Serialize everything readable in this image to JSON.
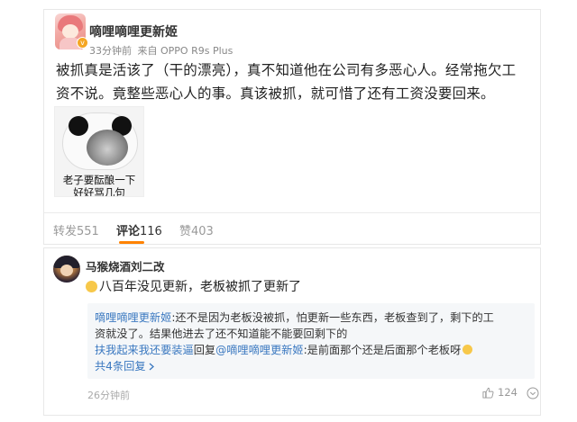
{
  "post": {
    "username": "嘀哩嘀哩更新姬",
    "time": "33分钟前",
    "source_prefix": "来自",
    "source": "OPPO R9s Plus",
    "text": "被抓真是活该了（干的漂亮），真不知道他在公司有多恶心人。经常拖欠工资不说。竟整些恶心人的事。真该被抓，就可惜了还有工资没要回来。",
    "meme_caption_line1": "老子要酝酿一下",
    "meme_caption_line2": "好好骂几句"
  },
  "tabs": [
    {
      "label": "转发",
      "count": "551"
    },
    {
      "label": "评论",
      "count": "116"
    },
    {
      "label": "赞",
      "count": "403"
    }
  ],
  "comment": {
    "username": "马猴烧酒刘二改",
    "text": "八百年没见更新，老板被抓了更新了",
    "reply1_user": "嘀哩嘀哩更新姬",
    "reply1_text_a": ":还不是因为老板没被抓，怕更新一些东西，老板查到了，剩下的工",
    "reply1_text_b": "资就没了。结果他进去了还不知道能不能要回剩下的",
    "reply2_user": "扶我起来我还要装逼",
    "reply2_mid": "回复",
    "reply2_target": "@嘀哩嘀哩更新姬",
    "reply2_text": ":是前面那个还是后面那个老板呀",
    "more_replies": "共4条回复",
    "time": "26分钟前",
    "likes": "124"
  },
  "colors": {
    "accent": "#ff8200",
    "link": "#3a78c0",
    "badge": "#f5a623"
  },
  "icons": {
    "verified": "verified-badge-icon",
    "like": "thumbs-up-icon",
    "more": "more-circle-icon",
    "smile": "smile-emoji-icon",
    "laugh": "laugh-emoji-icon",
    "chevron": "chevron-right-icon"
  }
}
